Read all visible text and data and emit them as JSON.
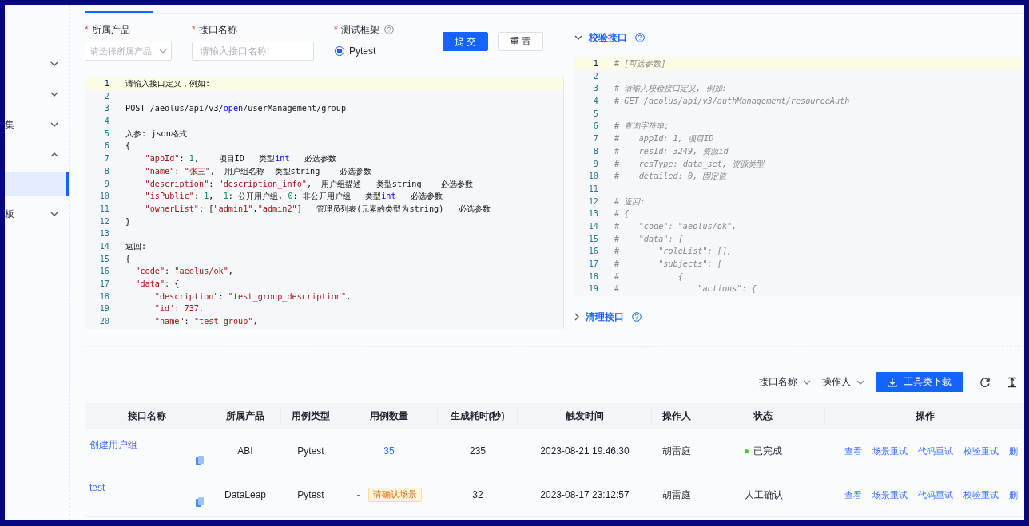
{
  "sidebar": {
    "items": [
      {
        "expanded": false,
        "selected": false
      },
      {
        "expanded": false,
        "selected": false
      },
      {
        "label": "集",
        "expanded": false,
        "selected": false
      },
      {
        "expanded": true,
        "selected": false,
        "children": [
          {
            "selected": true
          }
        ]
      },
      {
        "label": "板",
        "expanded": false,
        "selected": false
      }
    ]
  },
  "tabs": [
    {
      "selected": true
    }
  ],
  "form": {
    "fields": [
      {
        "kind": "select",
        "mark": "*",
        "label": "所属产品",
        "placeholder": "请选择所属产品"
      },
      {
        "kind": "input",
        "mark": "*",
        "label": "接口名称",
        "placeholder": "请输入接口名称!"
      },
      {
        "kind": "radio",
        "mark": "*",
        "label": "测试框架",
        "help": true,
        "options": [
          {
            "label": "Pytest",
            "selected": true
          }
        ]
      }
    ],
    "buttons": [
      {
        "label": "提 交",
        "kind": "primary"
      },
      {
        "label": "重 置",
        "kind": "default"
      }
    ]
  },
  "editor": {
    "lines": [
      {
        "n": "1",
        "current": true,
        "tokens": [
          {
            "text": "请输入接口定义，例如:",
            "kind": "plain"
          }
        ]
      },
      {
        "n": "2",
        "current": false
      },
      {
        "n": "3",
        "current": false,
        "tokens": [
          {
            "text": "POST /aeolus/api/v3/",
            "kind": "plain"
          },
          {
            "text": "open",
            "kind": "keyword"
          },
          {
            "text": "/userManagement/group",
            "kind": "plain"
          }
        ]
      },
      {
        "n": "4",
        "current": false
      },
      {
        "n": "5",
        "current": false,
        "tokens": [
          {
            "text": "入参: json格式",
            "kind": "plain"
          }
        ]
      },
      {
        "n": "6",
        "current": false,
        "tokens": [
          {
            "text": "{",
            "kind": "plain"
          }
        ]
      },
      {
        "n": "7",
        "current": false,
        "tokens": [
          {
            "text": "    \"appId\"",
            "kind": "string"
          },
          {
            "text": ": ",
            "kind": "plain"
          },
          {
            "text": "1",
            "kind": "number"
          },
          {
            "text": ",    项目ID   类型",
            "kind": "plain"
          },
          {
            "text": "int",
            "kind": "keyword"
          },
          {
            "text": "   必选参数",
            "kind": "plain"
          }
        ]
      },
      {
        "n": "8",
        "current": false,
        "tokens": [
          {
            "text": "    \"name\"",
            "kind": "string"
          },
          {
            "text": ": ",
            "kind": "plain"
          },
          {
            "text": "\"张三\"",
            "kind": "string"
          },
          {
            "text": ",  用户组名称  类型string    必选参数",
            "kind": "plain"
          }
        ]
      },
      {
        "n": "9",
        "current": false,
        "tokens": [
          {
            "text": "    \"description\"",
            "kind": "string"
          },
          {
            "text": ": ",
            "kind": "plain"
          },
          {
            "text": "\"description_info\"",
            "kind": "string"
          },
          {
            "text": ",  用户组描述   类型string    必选参数",
            "kind": "plain"
          }
        ]
      },
      {
        "n": "10",
        "current": false,
        "tokens": [
          {
            "text": "    \"isPublic\"",
            "kind": "string"
          },
          {
            "text": ": ",
            "kind": "plain"
          },
          {
            "text": "1",
            "kind": "number"
          },
          {
            "text": ",  ",
            "kind": "plain"
          },
          {
            "text": "1",
            "kind": "number"
          },
          {
            "text": ": 公开用户组, ",
            "kind": "plain"
          },
          {
            "text": "0",
            "kind": "number"
          },
          {
            "text": ": 非公开用户组   类型",
            "kind": "plain"
          },
          {
            "text": "int",
            "kind": "keyword"
          },
          {
            "text": "   必选参数",
            "kind": "plain"
          }
        ]
      },
      {
        "n": "11",
        "current": false,
        "tokens": [
          {
            "text": "    \"ownerList\"",
            "kind": "string"
          },
          {
            "text": ": [",
            "kind": "plain"
          },
          {
            "text": "\"admin1\"",
            "kind": "string"
          },
          {
            "text": ",",
            "kind": "plain"
          },
          {
            "text": "\"admin2\"",
            "kind": "string"
          },
          {
            "text": "]   管理员列表(元素的类型为string)   必选参数",
            "kind": "plain"
          }
        ]
      },
      {
        "n": "12",
        "current": false,
        "tokens": [
          {
            "text": "}",
            "kind": "plain"
          }
        ]
      },
      {
        "n": "13",
        "current": false
      },
      {
        "n": "14",
        "current": false,
        "tokens": [
          {
            "text": "返回:",
            "kind": "plain"
          }
        ]
      },
      {
        "n": "15",
        "current": false,
        "tokens": [
          {
            "text": "{",
            "kind": "plain"
          }
        ]
      },
      {
        "n": "16",
        "current": false,
        "tokens": [
          {
            "text": "  \"code\"",
            "kind": "string"
          },
          {
            "text": ": ",
            "kind": "plain"
          },
          {
            "text": "\"aeolus/ok\"",
            "kind": "string"
          },
          {
            "text": ",",
            "kind": "plain"
          }
        ]
      },
      {
        "n": "17",
        "current": false,
        "tokens": [
          {
            "text": "  \"data\"",
            "kind": "string"
          },
          {
            "text": ": {",
            "kind": "plain"
          }
        ]
      },
      {
        "n": "18",
        "current": false,
        "tokens": [
          {
            "text": "      \"description\"",
            "kind": "string"
          },
          {
            "text": ": ",
            "kind": "plain"
          },
          {
            "text": "\"test_group_description\"",
            "kind": "string"
          },
          {
            "text": ",",
            "kind": "plain"
          }
        ]
      },
      {
        "n": "19",
        "current": false,
        "tokens": [
          {
            "text": "      \"id': 737,",
            "kind": "string"
          }
        ]
      },
      {
        "n": "20",
        "current": false,
        "tokens": [
          {
            "text": "      \"name\"",
            "kind": "string"
          },
          {
            "text": ": ",
            "kind": "plain"
          },
          {
            "text": "\"test_group\",",
            "kind": "string"
          }
        ]
      }
    ]
  },
  "sections": [
    {
      "title": "校验接口",
      "expanded": true,
      "help": true,
      "editor": {
        "lines": [
          {
            "n": "1",
            "current": true,
            "tokens": [
              {
                "text": "# [可选参数]",
                "kind": "comment"
              }
            ]
          },
          {
            "n": "2",
            "current": false
          },
          {
            "n": "3",
            "current": false,
            "tokens": [
              {
                "text": "# 请输入校验接口定义, 例如:",
                "kind": "comment"
              }
            ]
          },
          {
            "n": "4",
            "current": false,
            "tokens": [
              {
                "text": "# GET /aeolus/api/v3/authManagement/resourceAuth",
                "kind": "comment"
              }
            ]
          },
          {
            "n": "5",
            "current": false
          },
          {
            "n": "6",
            "current": false,
            "tokens": [
              {
                "text": "# 查询字符串:",
                "kind": "comment"
              }
            ]
          },
          {
            "n": "7",
            "current": false,
            "tokens": [
              {
                "text": "#    appId: 1, 项目ID",
                "kind": "comment"
              }
            ]
          },
          {
            "n": "8",
            "current": false,
            "tokens": [
              {
                "text": "#    resId: 3249, 资源id",
                "kind": "comment"
              }
            ]
          },
          {
            "n": "9",
            "current": false,
            "tokens": [
              {
                "text": "#    resType: data_set, 资源类型",
                "kind": "comment"
              }
            ]
          },
          {
            "n": "10",
            "current": false,
            "tokens": [
              {
                "text": "#    detailed: 0, 固定值",
                "kind": "comment"
              }
            ]
          },
          {
            "n": "11",
            "current": false
          },
          {
            "n": "12",
            "current": false,
            "tokens": [
              {
                "text": "# 返回:",
                "kind": "comment"
              }
            ]
          },
          {
            "n": "13",
            "current": false,
            "tokens": [
              {
                "text": "# {",
                "kind": "comment"
              }
            ]
          },
          {
            "n": "14",
            "current": false,
            "tokens": [
              {
                "text": "#    \"code\": \"aeolus/ok\",",
                "kind": "comment"
              }
            ]
          },
          {
            "n": "15",
            "current": false,
            "tokens": [
              {
                "text": "#    \"data\": {",
                "kind": "comment"
              }
            ]
          },
          {
            "n": "16",
            "current": false,
            "tokens": [
              {
                "text": "#        \"roleList\": [],",
                "kind": "comment"
              }
            ]
          },
          {
            "n": "17",
            "current": false,
            "tokens": [
              {
                "text": "#        \"subjects\": [",
                "kind": "comment"
              }
            ]
          },
          {
            "n": "18",
            "current": false,
            "tokens": [
              {
                "text": "#            {",
                "kind": "comment"
              }
            ]
          },
          {
            "n": "19",
            "current": false,
            "tokens": [
              {
                "text": "#                \"actions\": {",
                "kind": "comment"
              }
            ]
          }
        ]
      }
    },
    {
      "title": "清理接口",
      "expanded": false,
      "help": true
    }
  ],
  "toolbar": {
    "filters": [
      {
        "label": "接口名称"
      },
      {
        "label": "操作人"
      }
    ],
    "button": "工具类下载"
  },
  "table": {
    "columns": [
      "接口名称",
      "所属产品",
      "用例类型",
      "用例数量",
      "生成耗时(秒)",
      "触发时间",
      "操作人",
      "状态",
      "操作"
    ],
    "rows": [
      {
        "name": "创建用户组",
        "product": "ABI",
        "case_type": "Pytest",
        "case_count": "35",
        "duration": "235",
        "time": "2023-08-21 19:46:30",
        "operator": "胡雷庭",
        "status": {
          "text": "已完成",
          "color": "#52c41a"
        },
        "actions": [
          "查看",
          "场景重试",
          "代码重试",
          "校验重试",
          "删"
        ]
      },
      {
        "name": "test",
        "product": "DataLeap",
        "case_type": "Pytest",
        "case_count": "-",
        "tag": "请确认场景",
        "duration": "32",
        "time": "2023-08-17 23:12:57",
        "operator": "胡雷庭",
        "status": {
          "text": "人工确认"
        },
        "actions": [
          "查看",
          "场景重试",
          "代码重试",
          "校验重试",
          "删"
        ]
      }
    ]
  }
}
